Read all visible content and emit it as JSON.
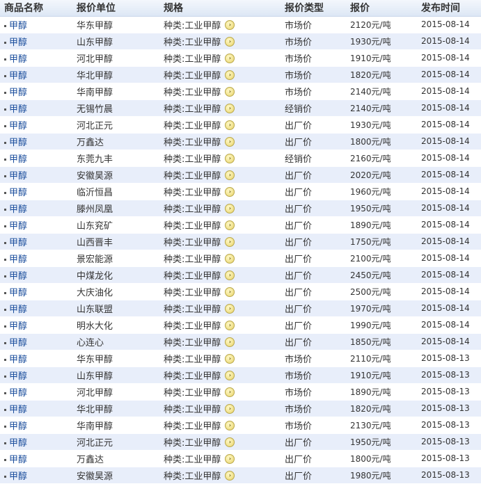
{
  "headers": [
    "商品名称",
    "报价单位",
    "规格",
    "报价类型",
    "报价",
    "发布时间"
  ],
  "rows": [
    {
      "name": "甲醇",
      "unit": "华东甲醇",
      "spec": "种类:工业甲醇",
      "type": "市场价",
      "price": "2120元/吨",
      "date": "2015-08-14"
    },
    {
      "name": "甲醇",
      "unit": "山东甲醇",
      "spec": "种类:工业甲醇",
      "type": "市场价",
      "price": "1930元/吨",
      "date": "2015-08-14"
    },
    {
      "name": "甲醇",
      "unit": "河北甲醇",
      "spec": "种类:工业甲醇",
      "type": "市场价",
      "price": "1910元/吨",
      "date": "2015-08-14"
    },
    {
      "name": "甲醇",
      "unit": "华北甲醇",
      "spec": "种类:工业甲醇",
      "type": "市场价",
      "price": "1820元/吨",
      "date": "2015-08-14"
    },
    {
      "name": "甲醇",
      "unit": "华南甲醇",
      "spec": "种类:工业甲醇",
      "type": "市场价",
      "price": "2140元/吨",
      "date": "2015-08-14"
    },
    {
      "name": "甲醇",
      "unit": "无锡竹晨",
      "spec": "种类:工业甲醇",
      "type": "经销价",
      "price": "2140元/吨",
      "date": "2015-08-14"
    },
    {
      "name": "甲醇",
      "unit": "河北正元",
      "spec": "种类:工业甲醇",
      "type": "出厂价",
      "price": "1930元/吨",
      "date": "2015-08-14"
    },
    {
      "name": "甲醇",
      "unit": "万鑫达",
      "spec": "种类:工业甲醇",
      "type": "出厂价",
      "price": "1800元/吨",
      "date": "2015-08-14"
    },
    {
      "name": "甲醇",
      "unit": "东莞九丰",
      "spec": "种类:工业甲醇",
      "type": "经销价",
      "price": "2160元/吨",
      "date": "2015-08-14"
    },
    {
      "name": "甲醇",
      "unit": "安徽昊源",
      "spec": "种类:工业甲醇",
      "type": "出厂价",
      "price": "2020元/吨",
      "date": "2015-08-14"
    },
    {
      "name": "甲醇",
      "unit": "临沂恒昌",
      "spec": "种类:工业甲醇",
      "type": "出厂价",
      "price": "1960元/吨",
      "date": "2015-08-14"
    },
    {
      "name": "甲醇",
      "unit": "滕州凤凰",
      "spec": "种类:工业甲醇",
      "type": "出厂价",
      "price": "1950元/吨",
      "date": "2015-08-14"
    },
    {
      "name": "甲醇",
      "unit": "山东兖矿",
      "spec": "种类:工业甲醇",
      "type": "出厂价",
      "price": "1890元/吨",
      "date": "2015-08-14"
    },
    {
      "name": "甲醇",
      "unit": "山西晋丰",
      "spec": "种类:工业甲醇",
      "type": "出厂价",
      "price": "1750元/吨",
      "date": "2015-08-14"
    },
    {
      "name": "甲醇",
      "unit": "景宏能源",
      "spec": "种类:工业甲醇",
      "type": "出厂价",
      "price": "2100元/吨",
      "date": "2015-08-14"
    },
    {
      "name": "甲醇",
      "unit": "中煤龙化",
      "spec": "种类:工业甲醇",
      "type": "出厂价",
      "price": "2450元/吨",
      "date": "2015-08-14"
    },
    {
      "name": "甲醇",
      "unit": "大庆油化",
      "spec": "种类:工业甲醇",
      "type": "出厂价",
      "price": "2500元/吨",
      "date": "2015-08-14"
    },
    {
      "name": "甲醇",
      "unit": "山东联盟",
      "spec": "种类:工业甲醇",
      "type": "出厂价",
      "price": "1970元/吨",
      "date": "2015-08-14"
    },
    {
      "name": "甲醇",
      "unit": "明水大化",
      "spec": "种类:工业甲醇",
      "type": "出厂价",
      "price": "1990元/吨",
      "date": "2015-08-14"
    },
    {
      "name": "甲醇",
      "unit": "心连心",
      "spec": "种类:工业甲醇",
      "type": "出厂价",
      "price": "1850元/吨",
      "date": "2015-08-14"
    },
    {
      "name": "甲醇",
      "unit": "华东甲醇",
      "spec": "种类:工业甲醇",
      "type": "市场价",
      "price": "2110元/吨",
      "date": "2015-08-13"
    },
    {
      "name": "甲醇",
      "unit": "山东甲醇",
      "spec": "种类:工业甲醇",
      "type": "市场价",
      "price": "1910元/吨",
      "date": "2015-08-13"
    },
    {
      "name": "甲醇",
      "unit": "河北甲醇",
      "spec": "种类:工业甲醇",
      "type": "市场价",
      "price": "1890元/吨",
      "date": "2015-08-13"
    },
    {
      "name": "甲醇",
      "unit": "华北甲醇",
      "spec": "种类:工业甲醇",
      "type": "市场价",
      "price": "1820元/吨",
      "date": "2015-08-13"
    },
    {
      "name": "甲醇",
      "unit": "华南甲醇",
      "spec": "种类:工业甲醇",
      "type": "市场价",
      "price": "2130元/吨",
      "date": "2015-08-13"
    },
    {
      "name": "甲醇",
      "unit": "河北正元",
      "spec": "种类:工业甲醇",
      "type": "出厂价",
      "price": "1950元/吨",
      "date": "2015-08-13"
    },
    {
      "name": "甲醇",
      "unit": "万鑫达",
      "spec": "种类:工业甲醇",
      "type": "出厂价",
      "price": "1800元/吨",
      "date": "2015-08-13"
    },
    {
      "name": "甲醇",
      "unit": "安徽昊源",
      "spec": "种类:工业甲醇",
      "type": "出厂价",
      "price": "1980元/吨",
      "date": "2015-08-13"
    }
  ],
  "arrow_icon": "arrow-circle-right-icon",
  "colors": {
    "link": "#1a4d9c",
    "row_alt": "#e8eefa",
    "header_bg": "#dde7f5"
  }
}
